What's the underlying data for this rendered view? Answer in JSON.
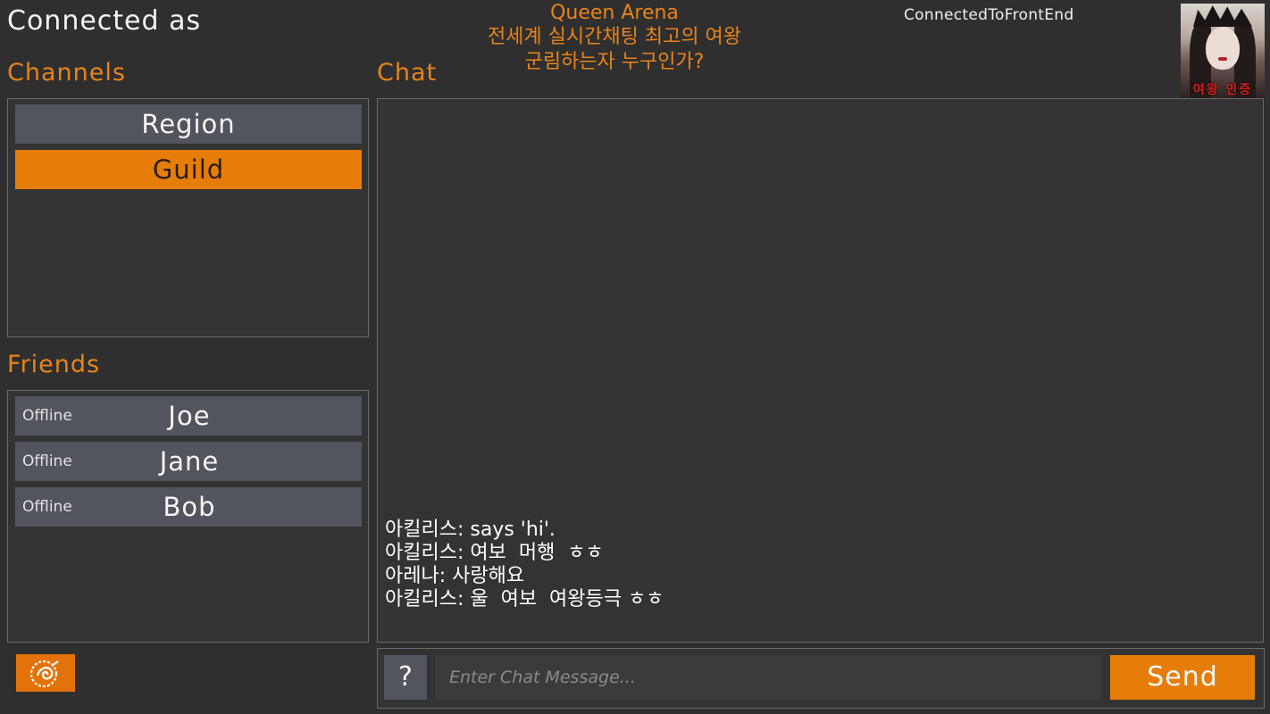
{
  "header": {
    "connected_label": "Connected as",
    "title_line1": "Queen Arena",
    "title_line2": "전세계 실시간채팅 최고의 여왕",
    "title_line3": "군림하는자 누구인가?",
    "status": "ConnectedToFrontEnd",
    "avatar_caption": "여왕 인증"
  },
  "channels": {
    "heading": "Channels",
    "items": [
      {
        "label": "Region",
        "active": false
      },
      {
        "label": "Guild",
        "active": true
      }
    ]
  },
  "friends": {
    "heading": "Friends",
    "items": [
      {
        "status": "Offline",
        "name": "Joe"
      },
      {
        "status": "Offline",
        "name": "Jane"
      },
      {
        "status": "Offline",
        "name": "Bob"
      }
    ]
  },
  "chat": {
    "heading": "Chat",
    "messages": [
      "아킬리스: says 'hi'.",
      "아킬리스: 여보  머행  ㅎㅎ",
      "아레나: 사랑해요",
      "아킬리스: 울  여보  여왕등극 ㅎㅎ"
    ],
    "input_placeholder": "Enter Chat Message...",
    "help_label": "?",
    "send_label": "Send"
  },
  "colors": {
    "accent": "#e57d08",
    "background": "#2f2f2f",
    "button_gray": "#52545e"
  },
  "icons": {
    "logo": "swirl-logo-icon"
  }
}
